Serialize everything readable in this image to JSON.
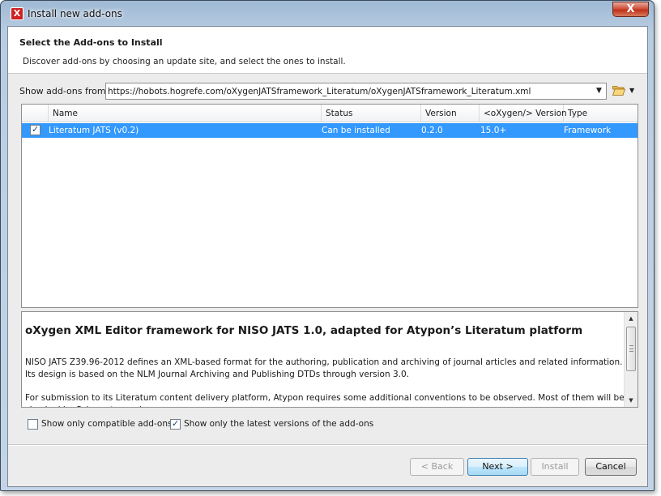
{
  "window": {
    "title": "Install new add-ons",
    "close_label": "X",
    "app_icon_letter": "X"
  },
  "header": {
    "title": "Select the Add-ons to Install",
    "description": "Discover add-ons by choosing an update site, and select the ones to install."
  },
  "source": {
    "label": "Show add-ons from:",
    "url": "https://hobots.hogrefe.com/oXygenJATSframework_Literatum/oXygenJATSframework_Literatum.xml",
    "icon": "folder-open-icon"
  },
  "table": {
    "columns": [
      "Name",
      "Status",
      "Version",
      "<oXygen/> Version",
      "Type"
    ],
    "rows": [
      {
        "checked": true,
        "name": "Literatum JATS (v0.2)",
        "status": "Can be installed",
        "version": "0.2.0",
        "oxygen_version": "15.0+",
        "type": "Framework"
      }
    ]
  },
  "details": {
    "title": "oXygen XML Editor framework for NISO JATS 1.0, adapted for Atypon’s Literatum platform",
    "paragraph1": "NISO JATS Z39.96-2012 defines an XML-based format for the authoring, publication and archiving of journal articles and related information. Its design is based on the NLM Journal Archiving and Publishing DTDs through version 3.0.",
    "paragraph2": "For submission to its Literatum content delivery platform, Atypon requires some additional conventions to be observed. Most of them will be checked by Schematron rules."
  },
  "options": {
    "compatible_only": {
      "label": "Show only compatible add-ons",
      "checked": false
    },
    "latest_only": {
      "label": "Show only the latest versions of the add-ons",
      "checked": true
    }
  },
  "buttons": {
    "back": "< Back",
    "next": "Next >",
    "install": "Install",
    "cancel": "Cancel"
  },
  "colors": {
    "selection": "#3399ff",
    "header_bg": "#ffffff",
    "dialog_bg": "#ececec"
  }
}
